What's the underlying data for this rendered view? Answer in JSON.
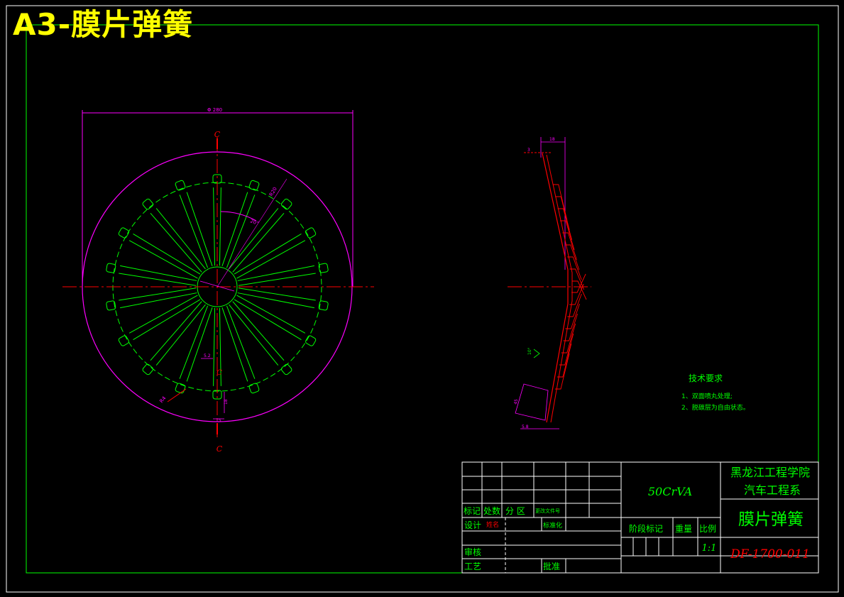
{
  "sheet_title": "A3-膜片弹簧",
  "colors": {
    "frame": "#ffffff",
    "border": "#00ff00",
    "part": "#00ff00",
    "centerline": "#ff0000",
    "dimension": "#ff00ff",
    "text_green": "#00ff00",
    "text_red": "#ff0000",
    "title_yellow": "#ffff00"
  },
  "front_view": {
    "slot_count": 18,
    "section_label": "C",
    "dimension_labels": {
      "overall_diameter": "Φ 280",
      "angle": "20°",
      "window_radius": "R20",
      "finger_width": "5.2",
      "lower_label": "15",
      "slot_depth": "18",
      "inner_radius": "R4"
    }
  },
  "side_view": {
    "dimension_labels": {
      "height": "18",
      "thickness": "3",
      "cone_angle": "10°",
      "bottom_width": "5.8",
      "chamfer": "45"
    }
  },
  "notes": {
    "heading": "技术要求",
    "items": [
      "1、双面喷丸处理;",
      "2、脱碳层为自由状态。"
    ]
  },
  "title_block": {
    "material": "50CrVA",
    "school": "黑龙江工程学院",
    "department": "汽车工程系",
    "part_name": "膜片弹簧",
    "drawing_number": "DF-1700-011",
    "scale": "1:1",
    "labels": {
      "mark": "标记",
      "count": "处数",
      "zone": "分 区",
      "change_doc": "更改文件号",
      "design": "设计",
      "designer": "姓名",
      "standard": "标准化",
      "stage_mark": "阶段标记",
      "weight": "重量",
      "scale_label": "比例",
      "review": "审核",
      "process": "工艺",
      "approve": "批准"
    }
  }
}
